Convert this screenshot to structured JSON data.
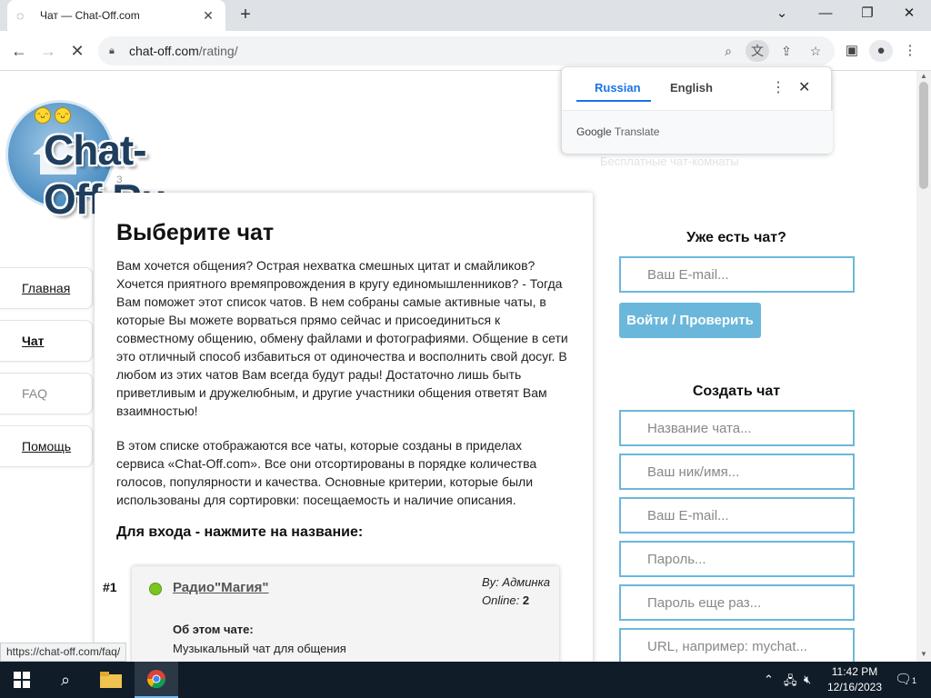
{
  "browser": {
    "tab_title": "Чат — Chat-Off.com",
    "tab_icon": "loading-icon",
    "url_host": "chat-off.com",
    "url_path": "/rating/",
    "status_url": "https://chat-off.com/faq/"
  },
  "translate_popup": {
    "lang_source": "Russian",
    "lang_target": "English",
    "brand_google": "Google",
    "brand_translate": "Translate"
  },
  "site": {
    "logo_text": "Chat-Off.Ru",
    "logo_sub": "З",
    "faint_header": "Бесплатные чат-комнаты",
    "nav": [
      "Главная",
      "Чат",
      "FAQ",
      "Помощь"
    ]
  },
  "main": {
    "title": "Выберите чат",
    "intro": "Вам хочется общения? Острая нехватка смешных цитат и смайликов? Хочется приятного времяпровождения в кругу единомышленников? - Тогда Вам поможет этот список чатов. В нем собраны самые активные чаты, в которые Вы можете ворваться прямо сейчас и присоединиться к совместному общению, обмену файлами и фотографиями. Общение в сети это отличный способ избавиться от одиночества и восполнить свой досуг. В любом из этих чатов Вам всегда будут рады! Достаточно лишь быть приветливым и дружелюбным, и другие участники общения ответят Вам взаимностью!",
    "desc": "В этом списке отображаются все чаты, которые созданы в приделах сервиса «Chat-Off.com». Все они отсортированы в порядке количества голосов, популярности и качества. Основные критерии, которые были использованы для сортировки: посещаемость и наличие описания.",
    "enter_hint": "Для входа - нажмите на название:"
  },
  "chat_list": [
    {
      "rank": "#1",
      "name": "Радио\"Магия\"",
      "by_label": "By:",
      "by_value": "Админка",
      "online_label": "Online:",
      "online_value": "2",
      "about_label": "Об этом чате:",
      "about_text": "Музыкальный чат для общения"
    }
  ],
  "login": {
    "heading": "Уже есть чат?",
    "email_placeholder": "Ваш E-mail...",
    "button": "Войти / Проверить"
  },
  "create": {
    "heading": "Создать чат",
    "fields": [
      "Название чата...",
      "Ваш ник/имя...",
      "Ваш E-mail...",
      "Пароль...",
      "Пароль еще раз...",
      "URL, например: mychat..."
    ]
  },
  "taskbar": {
    "time": "11:42 PM",
    "date": "12/16/2023",
    "notifications": "1"
  }
}
